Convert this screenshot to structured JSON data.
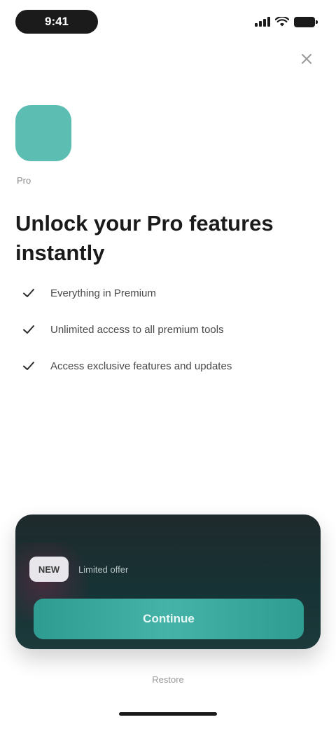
{
  "status_bar": {
    "time": "9:41"
  },
  "app": {
    "caption": "Pro",
    "icon_color": "#5cbdb2"
  },
  "headline": "Unlock your Pro features instantly",
  "features": [
    {
      "icon": "check-icon",
      "text": "Everything in Premium"
    },
    {
      "icon": "check-icon",
      "text": "Unlimited access to all premium tools"
    },
    {
      "icon": "check-icon",
      "text": "Access exclusive features and updates"
    }
  ],
  "promo": {
    "badge": "NEW",
    "text": "Limited offer",
    "cta_label": "Continue"
  },
  "footer": {
    "restore_label": "Restore"
  },
  "colors": {
    "accent": "#45b3a8",
    "card_background": "#1f2a2c"
  }
}
